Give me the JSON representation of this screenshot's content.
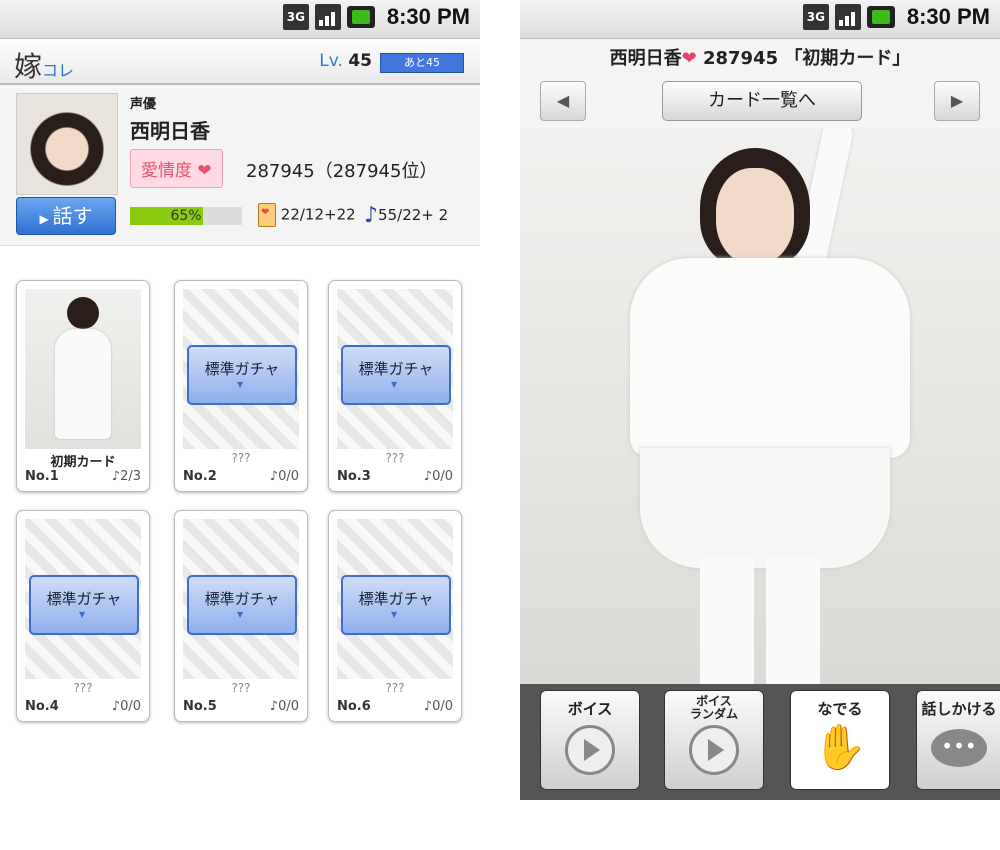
{
  "status": {
    "network": "3G",
    "time": "8:30 PM"
  },
  "left": {
    "header": {
      "logo_main": "嫁",
      "logo_accent": "コレ",
      "level_label": "Lv.",
      "level_value": "45",
      "exp_text": "あと45"
    },
    "profile": {
      "job": "声優",
      "name": "西明日香",
      "love_label": "愛情度",
      "score": "287945（287945位）",
      "talk_label": "話す",
      "progress_text": "65%",
      "progress_value": 65,
      "cards_stat": "22/12+22",
      "voice_stat": "55/22+ 2"
    },
    "cards": [
      {
        "name": "初期カード",
        "no": "No.1",
        "voice": "♪2/3",
        "gacha": ""
      },
      {
        "name": "???",
        "no": "No.2",
        "voice": "♪0/0",
        "gacha": "標準ガチャ"
      },
      {
        "name": "???",
        "no": "No.3",
        "voice": "♪0/0",
        "gacha": "標準ガチャ"
      },
      {
        "name": "???",
        "no": "No.4",
        "voice": "♪0/0",
        "gacha": "標準ガチャ"
      },
      {
        "name": "???",
        "no": "No.5",
        "voice": "♪0/0",
        "gacha": "標準ガチャ"
      },
      {
        "name": "???",
        "no": "No.6",
        "voice": "♪0/0",
        "gacha": "標準ガチャ"
      }
    ]
  },
  "right": {
    "title_name": "西明日香",
    "title_rest": "287945 「初期カード」",
    "list_button": "カード一覧へ",
    "prev": "◀",
    "next": "▶",
    "actions": {
      "voice": "ボイス",
      "voice_random_1": "ボイス",
      "voice_random_2": "ランダム",
      "stroke": "なでる",
      "speak": "話しかける"
    }
  },
  "colors": {
    "accent_blue": "#2f71d1",
    "love_pink": "#e2566f",
    "progress_green": "#8acb12"
  }
}
